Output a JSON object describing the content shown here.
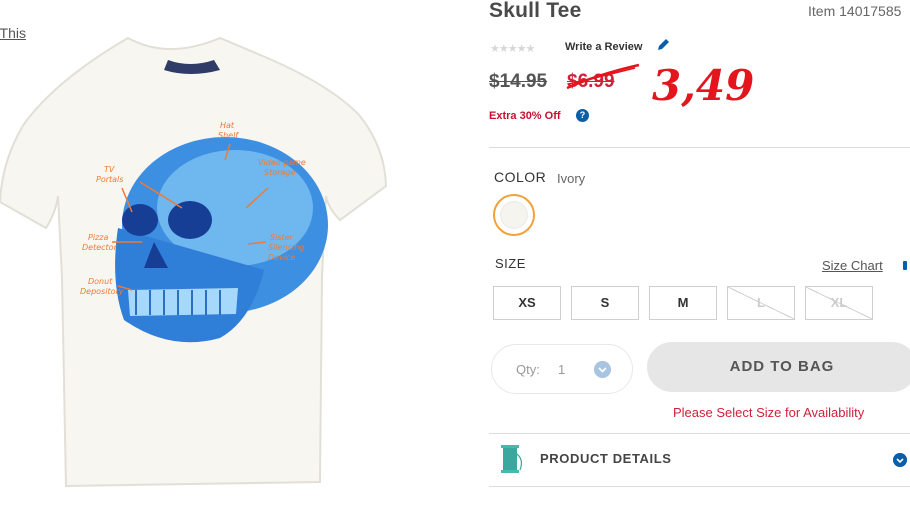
{
  "share": {
    "label": "t This"
  },
  "product": {
    "title": "Skull Tee",
    "item_number": "Item 14017585",
    "stars": "★★★★★",
    "write_review": "Write a Review",
    "price_original": "$14.95",
    "price_sale": "$6.99",
    "handwritten_price": "3,49",
    "extra_offer": "Extra 30% Off",
    "help_icon": "?"
  },
  "image": {
    "annotations": [
      "Hat Shelf",
      "Video game Storage",
      "TV Portals",
      "Pizza Detector",
      "Sister Silencing Device",
      "Donut Depository"
    ]
  },
  "color": {
    "label": "COLOR",
    "value": "Ivory"
  },
  "size": {
    "label": "SIZE",
    "chart_label": "Size Chart",
    "options": [
      "XS",
      "S",
      "M",
      "L",
      "XL"
    ]
  },
  "qty": {
    "label": "Qty:",
    "value": "1"
  },
  "add_to_bag": "ADD TO BAG",
  "availability": "Please Select Size for Availability",
  "details": {
    "label": "PRODUCT DETAILS"
  },
  "colors": {
    "sale": "#d0213a",
    "handwritten": "#e2161c",
    "brand_blue": "#0b5ea8",
    "swatch_ring": "#f0a23b",
    "swatch_fill": "#f6f4ee"
  },
  "icons": [
    "pencil-icon",
    "help-icon",
    "ruler-icon",
    "chevron-down-icon",
    "spool-icon"
  ]
}
